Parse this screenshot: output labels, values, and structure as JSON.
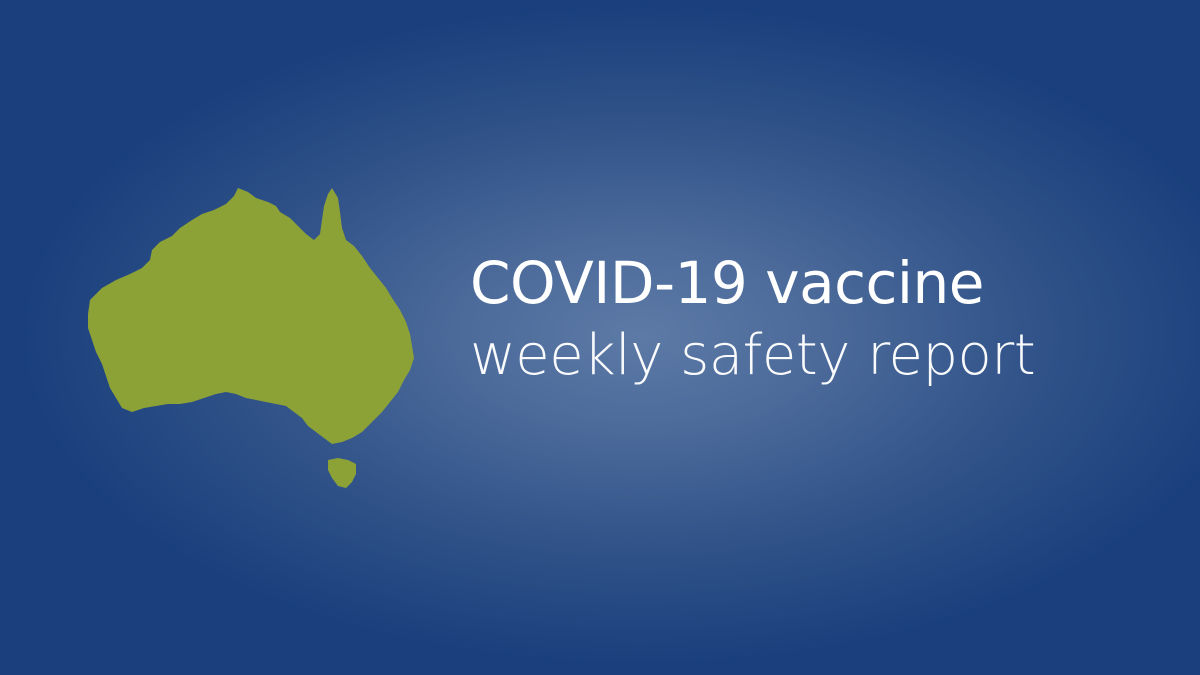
{
  "banner": {
    "title_line1": "COVID-19 vaccine",
    "title_line2": "weekly safety report",
    "map_icon": "australia-map-icon",
    "colors": {
      "background_edge": "#1a3f7c",
      "background_center": "#5d7aa6",
      "map_fill": "#8da236",
      "text": "#ffffff"
    }
  }
}
